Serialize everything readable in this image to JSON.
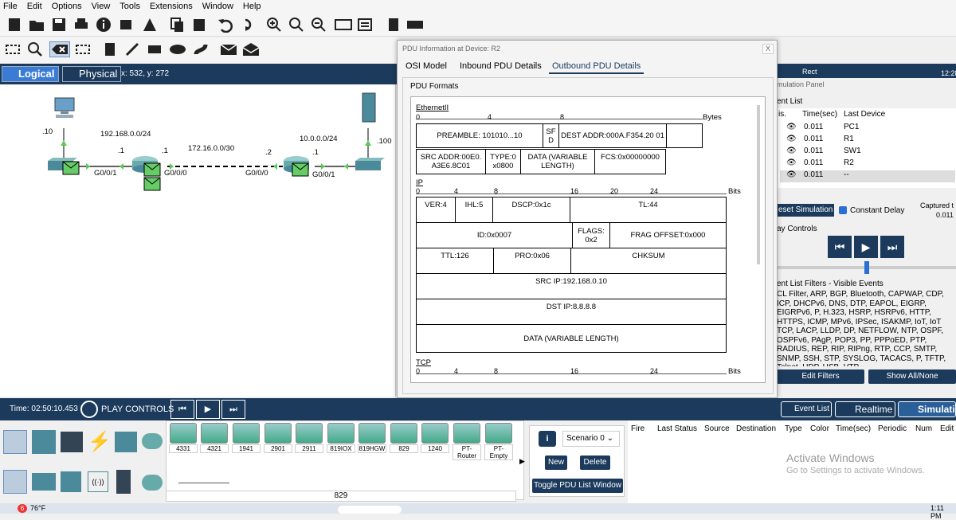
{
  "menu": [
    "File",
    "Edit",
    "Options",
    "View",
    "Tools",
    "Extensions",
    "Window",
    "Help"
  ],
  "modes": {
    "logical": "Logical",
    "physical": "Physical",
    "coords": "x: 532, y: 272"
  },
  "topology": {
    "labels": [
      ".10",
      "192.168.0.0/24",
      ".1",
      ".1",
      "172.16.0.0/30",
      ".2",
      "10.0.0.0/24",
      ".1",
      ".100",
      "G0/0/1",
      "G0/0/0",
      "G0/0/0",
      "G0/0/1"
    ]
  },
  "dialog": {
    "title": "PDU Information at Device: R2",
    "close": "X",
    "tabs": [
      "OSI Model",
      "Inbound PDU Details",
      "Outbound PDU Details"
    ],
    "formats_label": "PDU Formats",
    "ethernet": {
      "title": "EthernetII",
      "scale": [
        "0",
        "4",
        "8"
      ],
      "unit": "Bytes",
      "preamble": "PREAMBLE: 101010...10",
      "sfd": "SF D",
      "dest": "DEST ADDR:000A.F354.20 01",
      "src": "SRC ADDR:00E0. A3E6.8C01",
      "type": "TYPE:0 x0800",
      "data": "DATA (VARIABLE LENGTH)",
      "fcs": "FCS:0x00000000"
    },
    "ip": {
      "title": "IP",
      "scale": [
        "0",
        "4",
        "8",
        "16",
        "20",
        "24"
      ],
      "unit": "Bits",
      "ver": "VER:4",
      "ihl": "IHL:5",
      "dscp": "DSCP:0x1c",
      "tl": "TL:44",
      "id": "ID:0x0007",
      "flags": "FLAGS: 0x2",
      "frag": "FRAG OFFSET:0x000",
      "ttl": "TTL:126",
      "pro": "PRO:0x06",
      "chk": "CHKSUM",
      "src": "SRC IP:192.168.0.10",
      "dst": "DST IP:8.8.8.8",
      "data": "DATA (VARIABLE LENGTH)"
    },
    "tcp": {
      "title": "TCP",
      "scale": [
        "0",
        "4",
        "8",
        "16",
        "24"
      ],
      "unit": "Bits"
    }
  },
  "sim": {
    "mode_label": "Rect",
    "clock": "12:28",
    "panel_title": "mulation Panel",
    "event_list_title": "ent List",
    "columns": [
      "is.",
      "Time(sec)",
      "Last Device"
    ],
    "events": [
      {
        "time": "0.011",
        "device": "PC1"
      },
      {
        "time": "0.011",
        "device": "R1"
      },
      {
        "time": "0.011",
        "device": "SW1"
      },
      {
        "time": "0.011",
        "device": "R2"
      },
      {
        "time": "0.011",
        "device": "--"
      }
    ],
    "reset": "eset Simulation",
    "constant_delay": "Constant Delay",
    "captured": "Captured t",
    "captured_val": "0.011",
    "play_controls": "ay Controls",
    "filters_title": "ent List Filters - Visible Events",
    "filters_text": "CL Filter, ARP, BGP, Bluetooth, CAPWAP, CDP, ICP, DHCPv6, DNS, DTP, EAPOL, EIGRP, EIGRPv6, P, H.323, HSRP, HSRPv6, HTTP, HTTPS, ICMP, MPv6, IPSec, ISAKMP, IoT, IoT TCP, LACP, LLDP, DP, NETFLOW, NTP, OSPF, OSPFv6, PAgP, POP3, PP, PPPoED, PTP, RADIUS, REP, RIP, RIPng, RTP, CCP, SMTP, SNMP, SSH, STP, SYSLOG, TACACS, P, TFTP, Telnet, UDP, USB, VTP",
    "edit_filters": "Edit Filters",
    "show_all": "Show All/None"
  },
  "bottom": {
    "time": "Time: 02:50:10.453",
    "play": "PLAY CONTROLS",
    "event_list": "Event List",
    "realtime": "Realtime",
    "simulation": "Simulati"
  },
  "models": [
    "4331",
    "4321",
    "1941",
    "2901",
    "2911",
    "819IOX",
    "819HGW",
    "829",
    "1240",
    "PT-Router",
    "PT-Empty"
  ],
  "selected_model": "829",
  "scenario": {
    "label": "Scenario 0",
    "new": "New",
    "delete": "Delete",
    "toggle": "Toggle PDU List Window"
  },
  "pdu_columns": [
    "Fire",
    "Last Status",
    "Source",
    "Destination",
    "Type",
    "Color",
    "Time(sec)",
    "Periodic",
    "Num",
    "Edit"
  ],
  "watermark": {
    "line1": "Activate Windows",
    "line2": "Go to Settings to activate Windows."
  },
  "taskbar": {
    "temp": "76°F",
    "badge": "6",
    "time": "1:11 PM"
  }
}
